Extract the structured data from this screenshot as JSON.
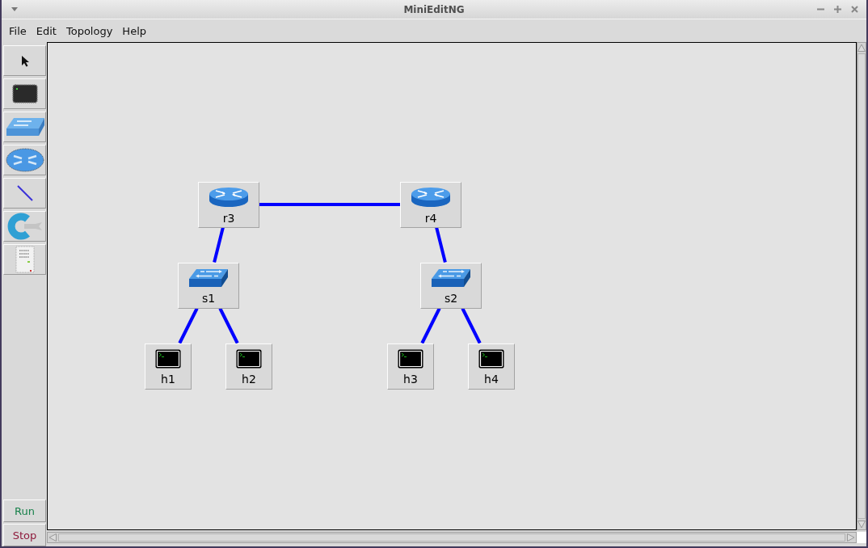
{
  "window": {
    "title": "MiniEditNG"
  },
  "menu": [
    "File",
    "Edit",
    "Topology",
    "Help"
  ],
  "nodes": [
    {
      "kind": "router",
      "label": "r3",
      "children": [
        {
          "kind": "switch",
          "label": "s1",
          "children": [
            {
              "kind": "host",
              "label": "h1"
            },
            {
              "kind": "host",
              "label": "h2"
            }
          ]
        },
        {
          "kind": "router",
          "label": "r4",
          "children": [
            {
              "kind": "switch",
              "label": "s2",
              "children": [
                {
                  "kind": "host",
                  "label": "h3"
                },
                {
                  "kind": "host",
                  "label": "h4"
                }
              ]
            }
          ]
        }
      ]
    }
  ],
  "run_button": "Run",
  "stop_button": "Stop"
}
